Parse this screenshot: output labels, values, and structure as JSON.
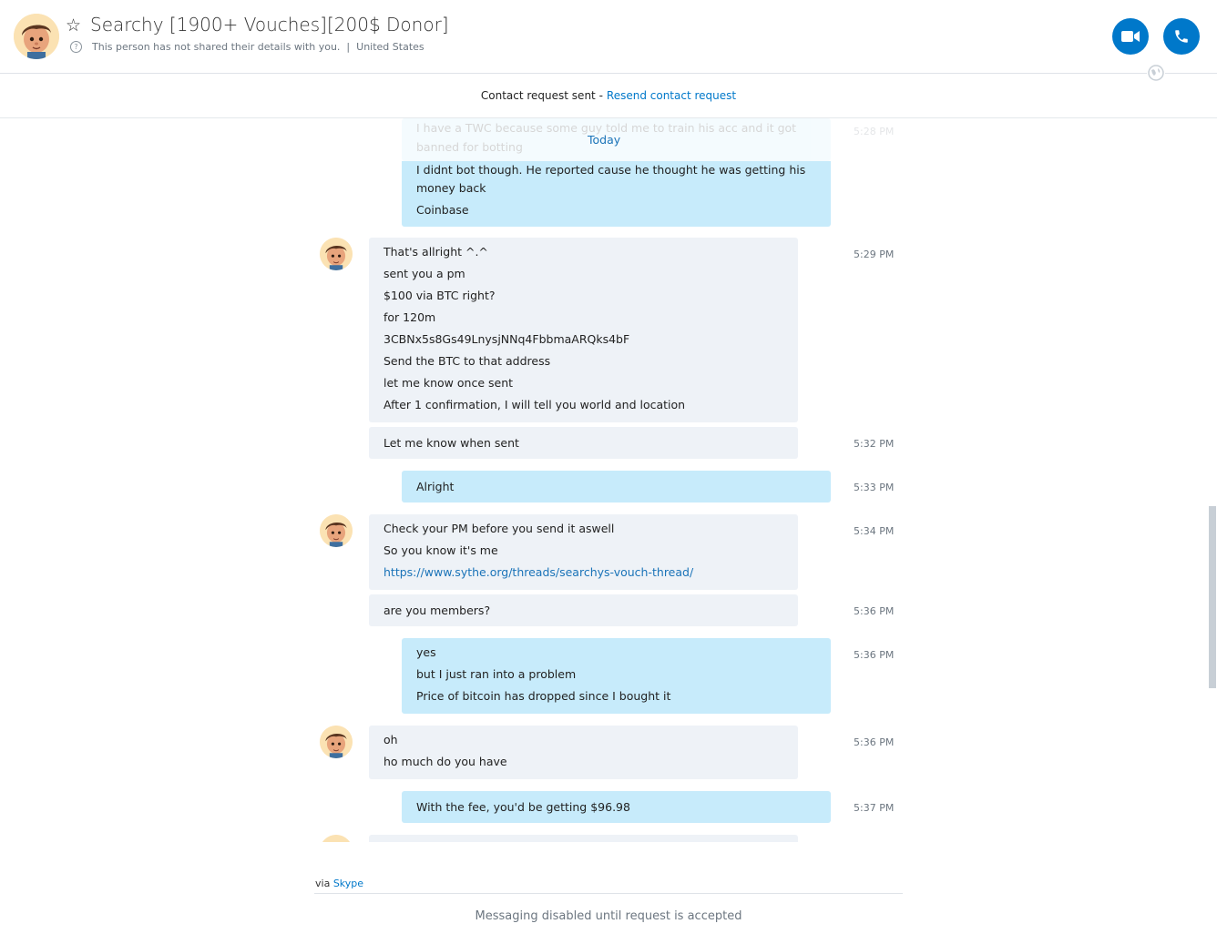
{
  "header": {
    "title": "Searchy [1900+ Vouches][200$ Donor]",
    "privacy_note": "This person has not shared their details with you.",
    "location": "United States",
    "separator": "|"
  },
  "request_bar": {
    "status": "Contact request sent -",
    "resend_link": "Resend contact request"
  },
  "date_divider": "Today",
  "messages": {
    "m0": {
      "lines": [
        "I have a TWC because some guy told me to train his acc and it got",
        "banned for botting"
      ]
    },
    "m1": {
      "lines": [
        "I didnt bot though. He reported cause he thought he was getting his",
        "money back",
        "Coinbase"
      ]
    },
    "m2": {
      "time": "5:29 PM",
      "lines": [
        "That's allright ^.^",
        "sent you a pm",
        "$100 via BTC right?",
        "for 120m",
        "3CBNx5s8Gs49LnysjNNq4FbbmaARQks4bF",
        "Send the BTC to that address",
        "let me know once sent",
        "After 1 confirmation, I will tell you world and location"
      ]
    },
    "m3": {
      "time": "5:32 PM",
      "lines": [
        "Let me know when sent"
      ]
    },
    "m4": {
      "time": "5:33 PM",
      "lines": [
        "Alright"
      ]
    },
    "m5": {
      "time": "5:34 PM",
      "lines": [
        "Check your PM before you send it aswell",
        "So you know it's me",
        "https://www.sythe.org/threads/searchys-vouch-thread/"
      ]
    },
    "m6": {
      "time": "5:36 PM",
      "lines": [
        "are you members?"
      ]
    },
    "m7": {
      "time": "5:36 PM",
      "lines": [
        "yes",
        "but I just ran into a problem",
        "Price of bitcoin has dropped since I bought it"
      ]
    },
    "m8": {
      "time": "5:36 PM",
      "lines": [
        "oh",
        "ho much do you have"
      ]
    },
    "m9": {
      "time": "5:37 PM",
      "lines": [
        "With the fee, you'd be getting $96.98"
      ]
    },
    "m0_time": "5:28 PM"
  },
  "footer": {
    "via_prefix": "via",
    "via_service": "Skype",
    "disabled_notice": "Messaging disabled until request is accepted"
  },
  "colors": {
    "accent": "#0078ca",
    "outgoing_bubble": "#c7ebfb",
    "incoming_bubble": "#eef2f7"
  },
  "icons": [
    "star-icon",
    "help-circle-icon",
    "video-call-icon",
    "phone-icon",
    "globe-icon",
    "contact-avatar"
  ]
}
